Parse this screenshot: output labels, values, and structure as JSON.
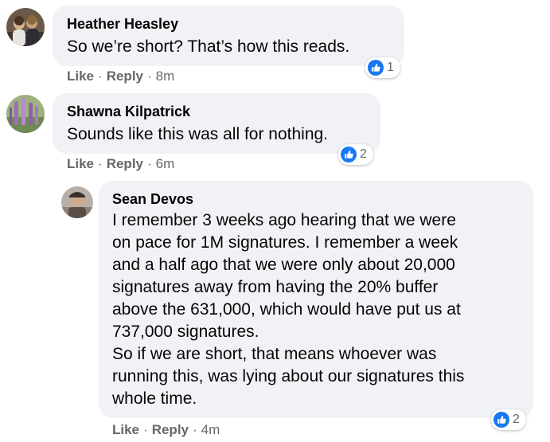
{
  "colors": {
    "bubble": "#f0f2f5",
    "like_blue": "#1877f2",
    "secondary_text": "#65676b"
  },
  "comments": [
    {
      "author": "Heather Heasley",
      "lines": [
        "So we’re short? That’s how this reads."
      ],
      "reaction_icon": "like-icon",
      "reaction_count": "1",
      "like_label": "Like",
      "reply_label": "Reply",
      "separator": "·",
      "timestamp": "8m"
    },
    {
      "author": "Shawna Kilpatrick",
      "lines": [
        "Sounds like this was all for nothing."
      ],
      "reaction_icon": "like-icon",
      "reaction_count": "2",
      "like_label": "Like",
      "reply_label": "Reply",
      "separator": "·",
      "timestamp": "6m"
    },
    {
      "author": "Sean Devos",
      "lines": [
        "I remember 3 weeks ago hearing that we were",
        "on pace for 1M signatures. I remember a week",
        "and a half ago that we were only about 20,000",
        "signatures away from having the 20% buffer",
        "above the 631,000, which would have put us at",
        "737,000 signatures.",
        "So if we are short, that means whoever was",
        "running this, was lying about our signatures this",
        "whole time."
      ],
      "reaction_icon": "like-icon",
      "reaction_count": "2",
      "like_label": "Like",
      "reply_label": "Reply",
      "separator": "·",
      "timestamp": "4m"
    }
  ]
}
